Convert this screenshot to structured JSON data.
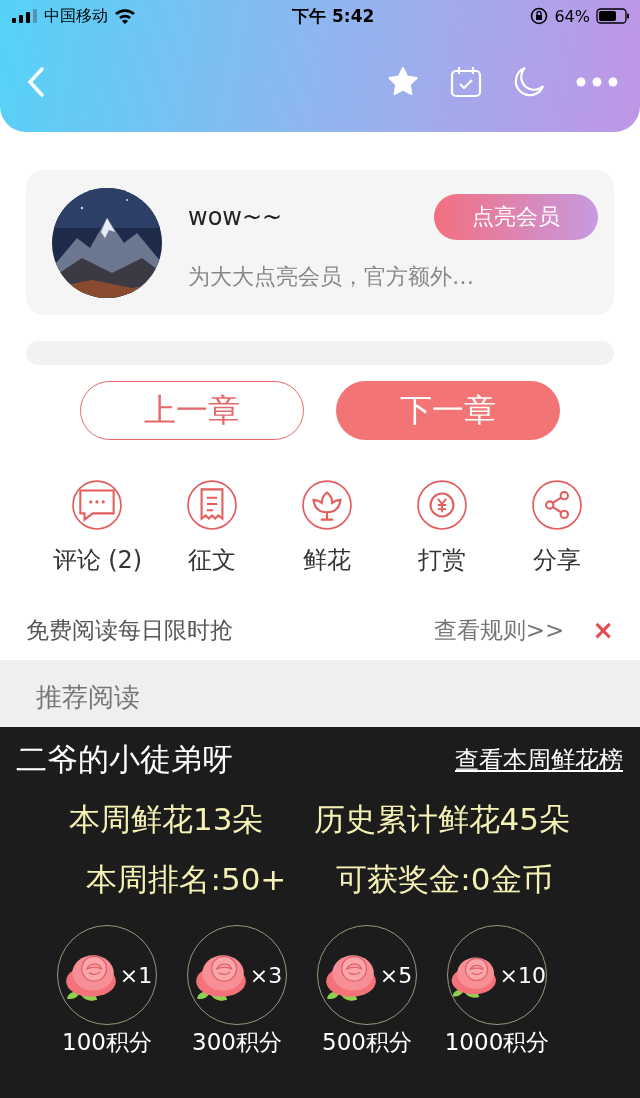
{
  "status_bar": {
    "carrier": "中国移动",
    "time": "下午 5:42",
    "battery": "64%"
  },
  "profile": {
    "name": "wow~~",
    "button": "点亮会员",
    "subtitle": "为大大点亮会员，官方额外…"
  },
  "chapter_buttons": [
    {
      "label": "上一章",
      "kind": "outline"
    },
    {
      "label": "下一章",
      "kind": "filled"
    }
  ],
  "actions": [
    {
      "label": "评论 (2)",
      "kind": "comment"
    },
    {
      "label": "征文",
      "kind": "essay"
    },
    {
      "label": "鲜花",
      "kind": "flower"
    },
    {
      "label": "打赏",
      "kind": "reward"
    },
    {
      "label": "分享",
      "kind": "share"
    }
  ],
  "notice": {
    "text": "免费阅读每日限时抢",
    "link": "查看规则>>",
    "close": "×"
  },
  "recommend": {
    "title": "推荐阅读"
  },
  "flower_panel": {
    "user": "二爷的小徒弟呀",
    "link": "查看本周鲜花榜",
    "stats": [
      [
        "本周鲜花13朵",
        "历史累计鲜花45朵"
      ],
      [
        "本周排名:50+",
        "可获奖金:0金币"
      ]
    ],
    "options": [
      {
        "count": "×1",
        "price": "100积分"
      },
      {
        "count": "×3",
        "price": "300积分"
      },
      {
        "count": "×5",
        "price": "500积分"
      },
      {
        "count": "×10",
        "price": "1000积分"
      }
    ]
  }
}
